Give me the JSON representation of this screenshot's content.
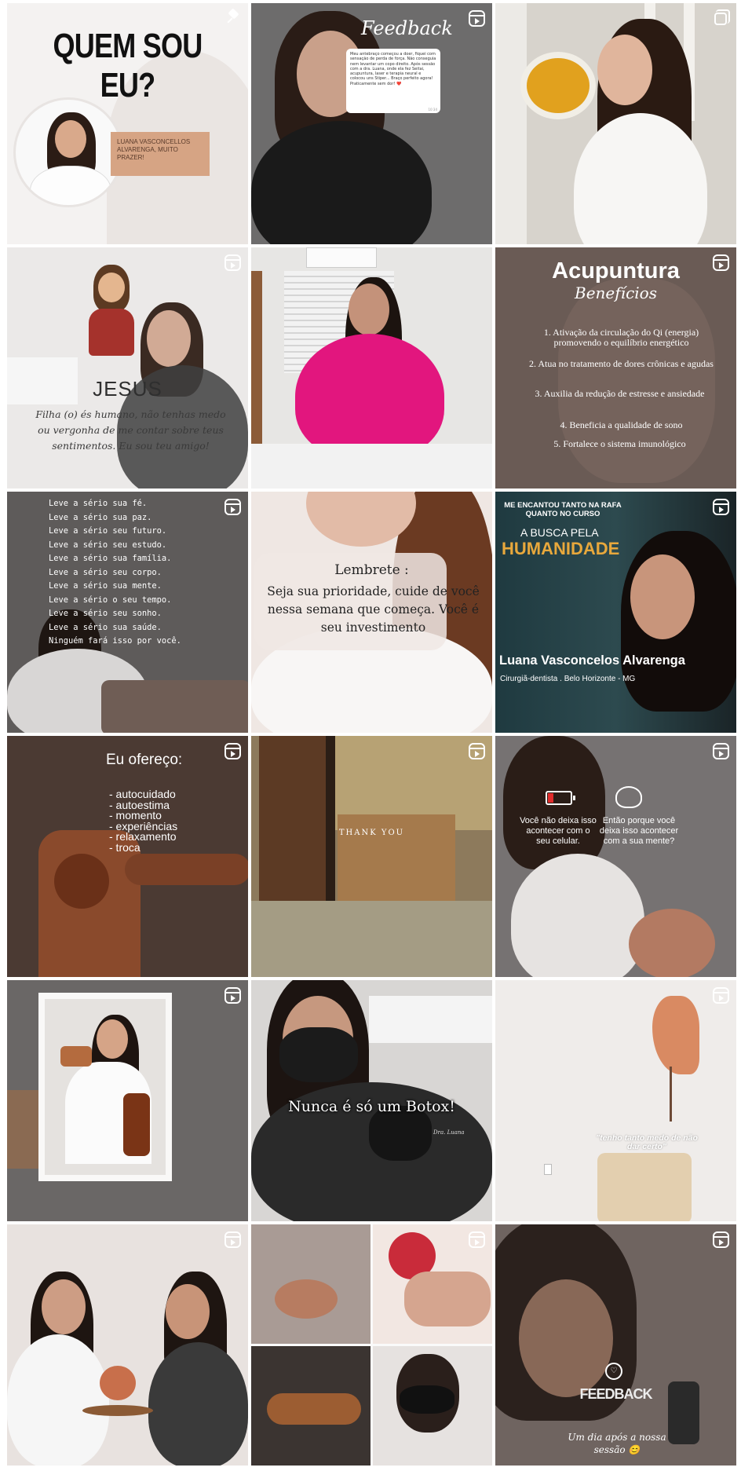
{
  "tiles": {
    "t1": {
      "title": "QUEM SOU EU?",
      "caption": "LUANA VASCONCELLOS ALVARENGA, MUITO PRAZER!",
      "badge": "pin-icon"
    },
    "t2": {
      "script_title": "Feedback",
      "message": "Meu antebraço começou a doer, fiquei com sensação de perda de força. Não conseguia nem levantar um copo direito. Após sessão com a dra. Luana, onde ela fez Seitai, acupuntura, laser e terapia neural e colocou uns Stiper... Braço perfeito agora! Praticamente sem dor! ❤️",
      "time": "10:34",
      "badge": "reel-icon"
    },
    "t3": {
      "badge": "carousel-icon"
    },
    "t4": {
      "title": "JESUS",
      "text": "Filha (o) és humano, não tenhas medo ou vergonha de me contar sobre teus sentimentos. Eu sou teu amigo!",
      "badge": "reel-icon"
    },
    "t5": {},
    "t6": {
      "title": "Acupuntura",
      "subtitle": "Benefícios",
      "items": [
        "1. Ativação da circulação do Qi (energia) promovendo o equilíbrio energético",
        "2. Atua no tratamento de dores crônicas e agudas",
        "3. Auxilia da redução de estresse e ansiedade",
        "4. Beneficia a qualidade de sono",
        "5. Fortalece o sistema imunológico"
      ],
      "badge": "reel-icon"
    },
    "t7": {
      "lines": [
        "Leve a sério sua fé.",
        "Leve a sério sua paz.",
        "Leve a sério seu futuro.",
        "Leve a sério seu estudo.",
        "Leve a sério sua família.",
        "Leve a sério seu corpo.",
        "Leve a sério sua mente.",
        "Leve a sério o seu tempo.",
        "Leve a sério seu sonho.",
        "Leve a sério sua saúde.",
        "Ninguém fará isso por você."
      ],
      "badge": "reel-icon"
    },
    "t8": {
      "title": "Lembrete :",
      "text": "Seja sua prioridade, cuide de você nessa semana que começa. Você é seu investimento"
    },
    "t9": {
      "top": "ME ENCANTOU TANTO NA RAFA QUANTO NO CURSO",
      "line1": "A BUSCA PELA",
      "line2": "HUMANIDADE",
      "name": "Luana Vasconcelos Alvarenga",
      "role": "Cirurgiã-dentista . Belo Horizonte - MG",
      "badge": "reel-icon"
    },
    "t10": {
      "title": "Eu ofereço:",
      "items": [
        "- autocuidado",
        "- autoestima",
        "- momento",
        "- experiências",
        "- relaxamento",
        "- troca"
      ],
      "badge": "reel-icon"
    },
    "t11": {
      "text": "THANK YOU",
      "badge": "reel-icon"
    },
    "t12": {
      "left": "Você não deixa isso acontecer com o seu celular.",
      "right": "Então porque você deixa isso acontecer com a sua mente?",
      "badge": "reel-icon"
    },
    "t13": {
      "badge": "reel-icon"
    },
    "t14": {
      "text": "Nunca é só um Botox!",
      "tag": "Dra. Luana"
    },
    "t15": {
      "quote": "\"tenho tanto medo de não dar certo\"",
      "badge": "reel-icon"
    },
    "t16": {
      "badge": "reel-icon"
    },
    "t17": {
      "badge": "reel-icon"
    },
    "t18": {
      "title": "FEEDBACK",
      "caption": "Um dia após a nossa sessão 😊",
      "badge": "reel-icon"
    }
  }
}
